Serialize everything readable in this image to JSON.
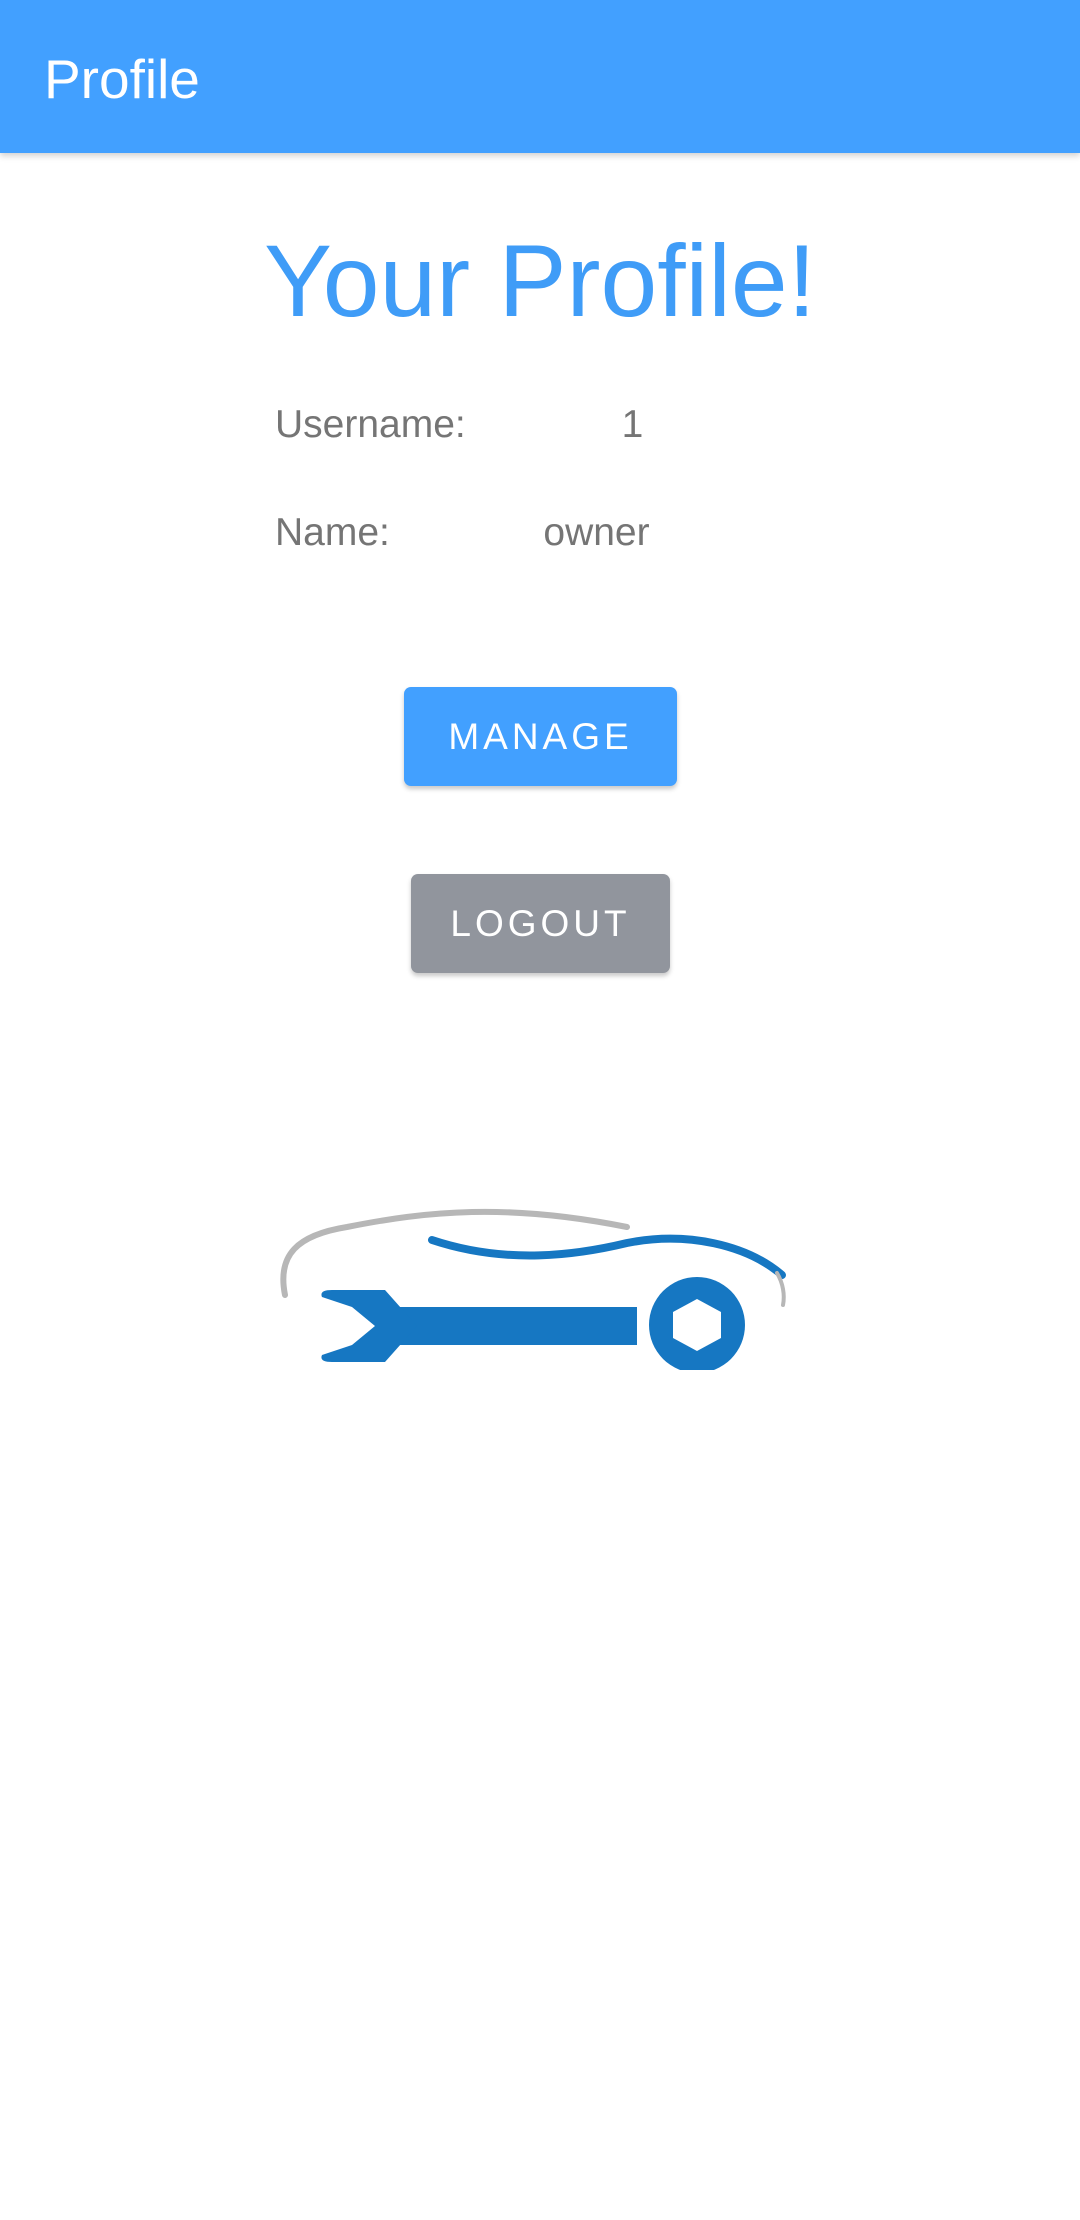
{
  "app_bar": {
    "title": "Profile"
  },
  "main": {
    "heading": "Your Profile!",
    "username": {
      "label": "Username:",
      "value": "1"
    },
    "name": {
      "label": "Name:",
      "value": "owner"
    },
    "buttons": {
      "manage_label": "MANAGE",
      "logout_label": "LOGOUT"
    },
    "logo": {
      "icon": "car-wrench-logo"
    }
  },
  "colors": {
    "primary": "#42a0ff",
    "heading": "#3f9cf7",
    "secondary_button": "#91959d",
    "text_muted": "#757575",
    "logo_blue": "#1677c2",
    "logo_gray": "#b7b7b7"
  }
}
